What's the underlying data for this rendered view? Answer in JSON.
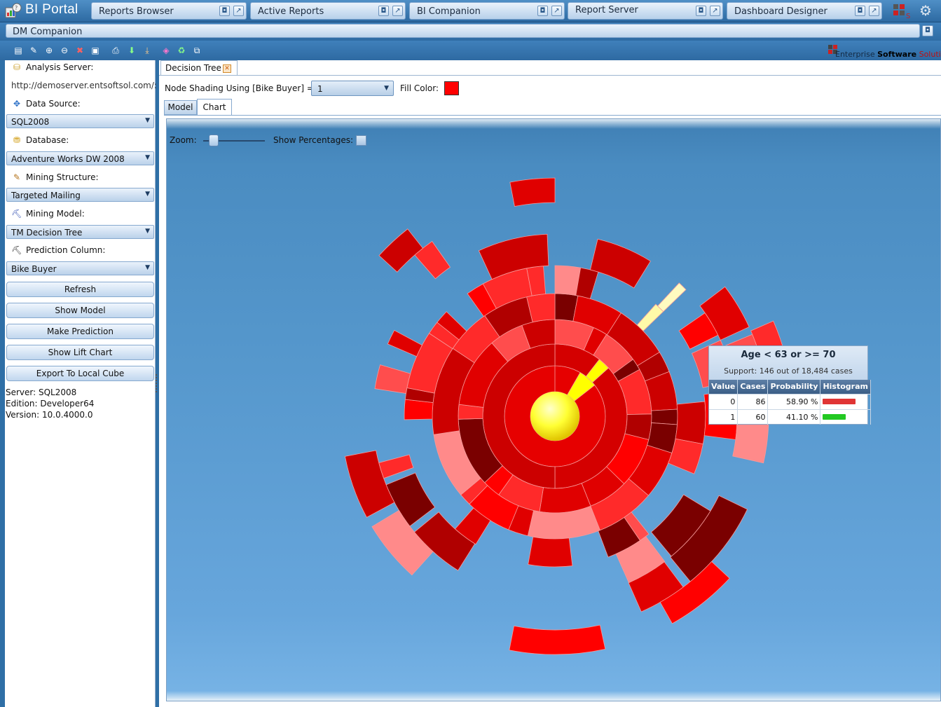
{
  "app": {
    "title": "BI Portal"
  },
  "portal_tabs": [
    {
      "label": "Reports Browser"
    },
    {
      "label": "Active Reports"
    },
    {
      "label": "BI Companion"
    },
    {
      "label": "Report Server"
    },
    {
      "label": "Dashboard Designer"
    }
  ],
  "dm_tab": {
    "label": "DM Companion"
  },
  "brand": {
    "name_prefix": "Enterprise ",
    "name_bold": "Software",
    "name_suffix": " Solution"
  },
  "left": {
    "analysis_server_label": "Analysis Server:",
    "analysis_server_value": "http://demoserver.entsoftsol.com/:",
    "data_source_label": "Data Source:",
    "data_source_value": "SQL2008",
    "database_label": "Database:",
    "database_value": "Adventure Works DW 2008",
    "mining_structure_label": "Mining Structure:",
    "mining_structure_value": "Targeted Mailing",
    "mining_model_label": "Mining Model:",
    "mining_model_value": "TM Decision Tree",
    "prediction_column_label": "Prediction Column:",
    "prediction_column_value": "Bike Buyer",
    "buttons": {
      "refresh": "Refresh",
      "show_model": "Show Model",
      "make_prediction": "Make Prediction",
      "show_lift_chart": "Show Lift Chart",
      "export_cube": "Export To Local Cube"
    },
    "info": {
      "server": "Server: SQL2008",
      "edition": "Edition: Developer64",
      "version": "Version: 10.0.4000.0"
    }
  },
  "main": {
    "doc_tab_label": "Decision Tree",
    "node_shading_label": "Node Shading Using [Bike Buyer] =",
    "node_shading_value": "1",
    "fill_color_label": "Fill Color:",
    "fill_color": "#ff0000",
    "subtabs": {
      "model": "Model",
      "chart": "Chart"
    },
    "zoom_label": "Zoom:",
    "zoom_level": 0.2,
    "show_percentages_label": "Show Percentages:",
    "show_percentages": false
  },
  "tooltip": {
    "title": "Age < 63 or >= 70",
    "support": "Support: 146 out of 18,484 cases",
    "headers": [
      "Value",
      "Cases",
      "Probability",
      "Histogram"
    ],
    "rows": [
      {
        "value": "0",
        "cases": "86",
        "probability": "58.90 %",
        "hist_fraction": 0.589,
        "hist_color": "#e03535"
      },
      {
        "value": "1",
        "cases": "60",
        "probability": "41.10 %",
        "hist_fraction": 0.411,
        "hist_color": "#22c922"
      }
    ]
  },
  "colors": {
    "accent": "#2f6fa6",
    "node_highlight": "#ffff00",
    "node_red": "#ff0000",
    "node_dark": "#7a0000",
    "node_light": "#ff8a8a"
  }
}
